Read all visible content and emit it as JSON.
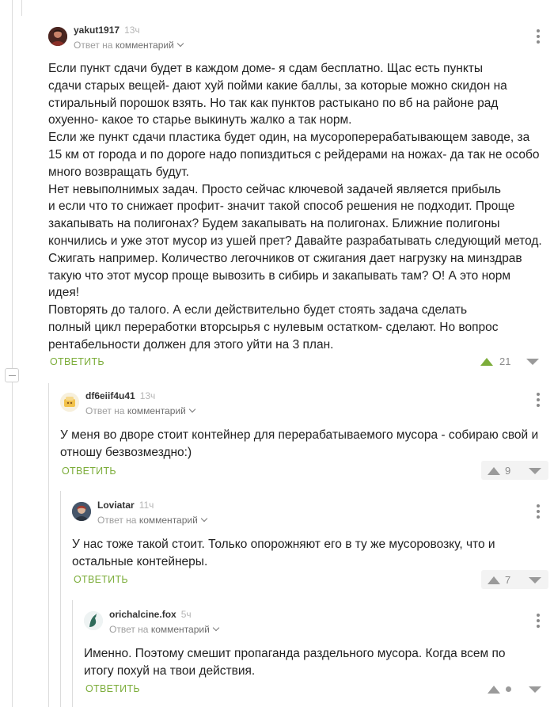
{
  "comments": [
    {
      "author": "yakut1917",
      "time": "13ч",
      "reply_prefix": "Ответ на",
      "reply_target": "комментарий",
      "avatar_icon": "user-avatar",
      "body": [
        "Если пункт сдачи будет в каждом доме- я сдам бесплатно. Щас есть пункты",
        "сдачи старых вещей- дают хуй пойми какие баллы, за которые можно скидон на",
        "стиральный порошок взять. Но так как пунктов растыкано по вб на районе рад",
        "охуенно- какое то старье выкинуть жалко а так норм.",
        "Если же пункт сдачи пластика будет один, на мусороперерабатывающем заводе, за",
        "15 км от города и по дороге надо попиздиться с рейдерами на ножах- да так не особо",
        "много возвращать будут.",
        "Нет невыполнимых задач. Просто сейчас ключевой задачей является прибыль",
        "и если что то снижает профит- значит такой способ решения не подходит. Проще",
        "закапывать на полигонах? Будем закапывать на полигонах. Ближние полигоны",
        "кончились и уже этот мусор из ушей прет? Давайте разрабатывать следующий метод.",
        "Сжигать например. Количество легочников от сжигания дает нагрузку на минздрав",
        "такую что этот мусор проще вывозить в сибирь и закапывать там? О! А это норм",
        "идея!",
        "Повторять до талого. А если действительно будет стоять задача сделать",
        "полный цикл переработки вторсырья с нулевым остатком- сделают. Но вопрос",
        "рентабельности должен для этого уйти на 3 план."
      ],
      "reply_label": "ОТВЕТИТЬ",
      "rating": "21"
    },
    {
      "author": "df6eiif4u41",
      "time": "13ч",
      "reply_prefix": "Ответ на",
      "reply_target": "комментарий",
      "body": [
        "У меня во дворе стоит контейнер для перерабатываемого мусора - собираю свой и",
        "отношу безвозмездно:)"
      ],
      "reply_label": "ОТВЕТИТЬ",
      "rating": "9"
    },
    {
      "author": "Loviatar",
      "time": "11ч",
      "reply_prefix": "Ответ на",
      "reply_target": "комментарий",
      "body": [
        "У нас тоже такой стоит. Только опорожняют его в ту же мусоровозку, что и",
        "остальные контейнеры."
      ],
      "reply_label": "ОТВЕТИТЬ",
      "rating": "7"
    },
    {
      "author": "orichalcine.fox",
      "time": "5ч",
      "reply_prefix": "Ответ на",
      "reply_target": "комментарий",
      "body": [
        "Именно. Поэтому смешит пропаганда раздельного мусора. Когда всем по",
        "итогу похуй на твои действия."
      ],
      "reply_label": "ОТВЕТИТЬ",
      "rating": ""
    }
  ],
  "colors": {
    "reply_green": "#7cad3a",
    "upvote_green": "#7cad3a",
    "muted": "#9a9a9a"
  }
}
